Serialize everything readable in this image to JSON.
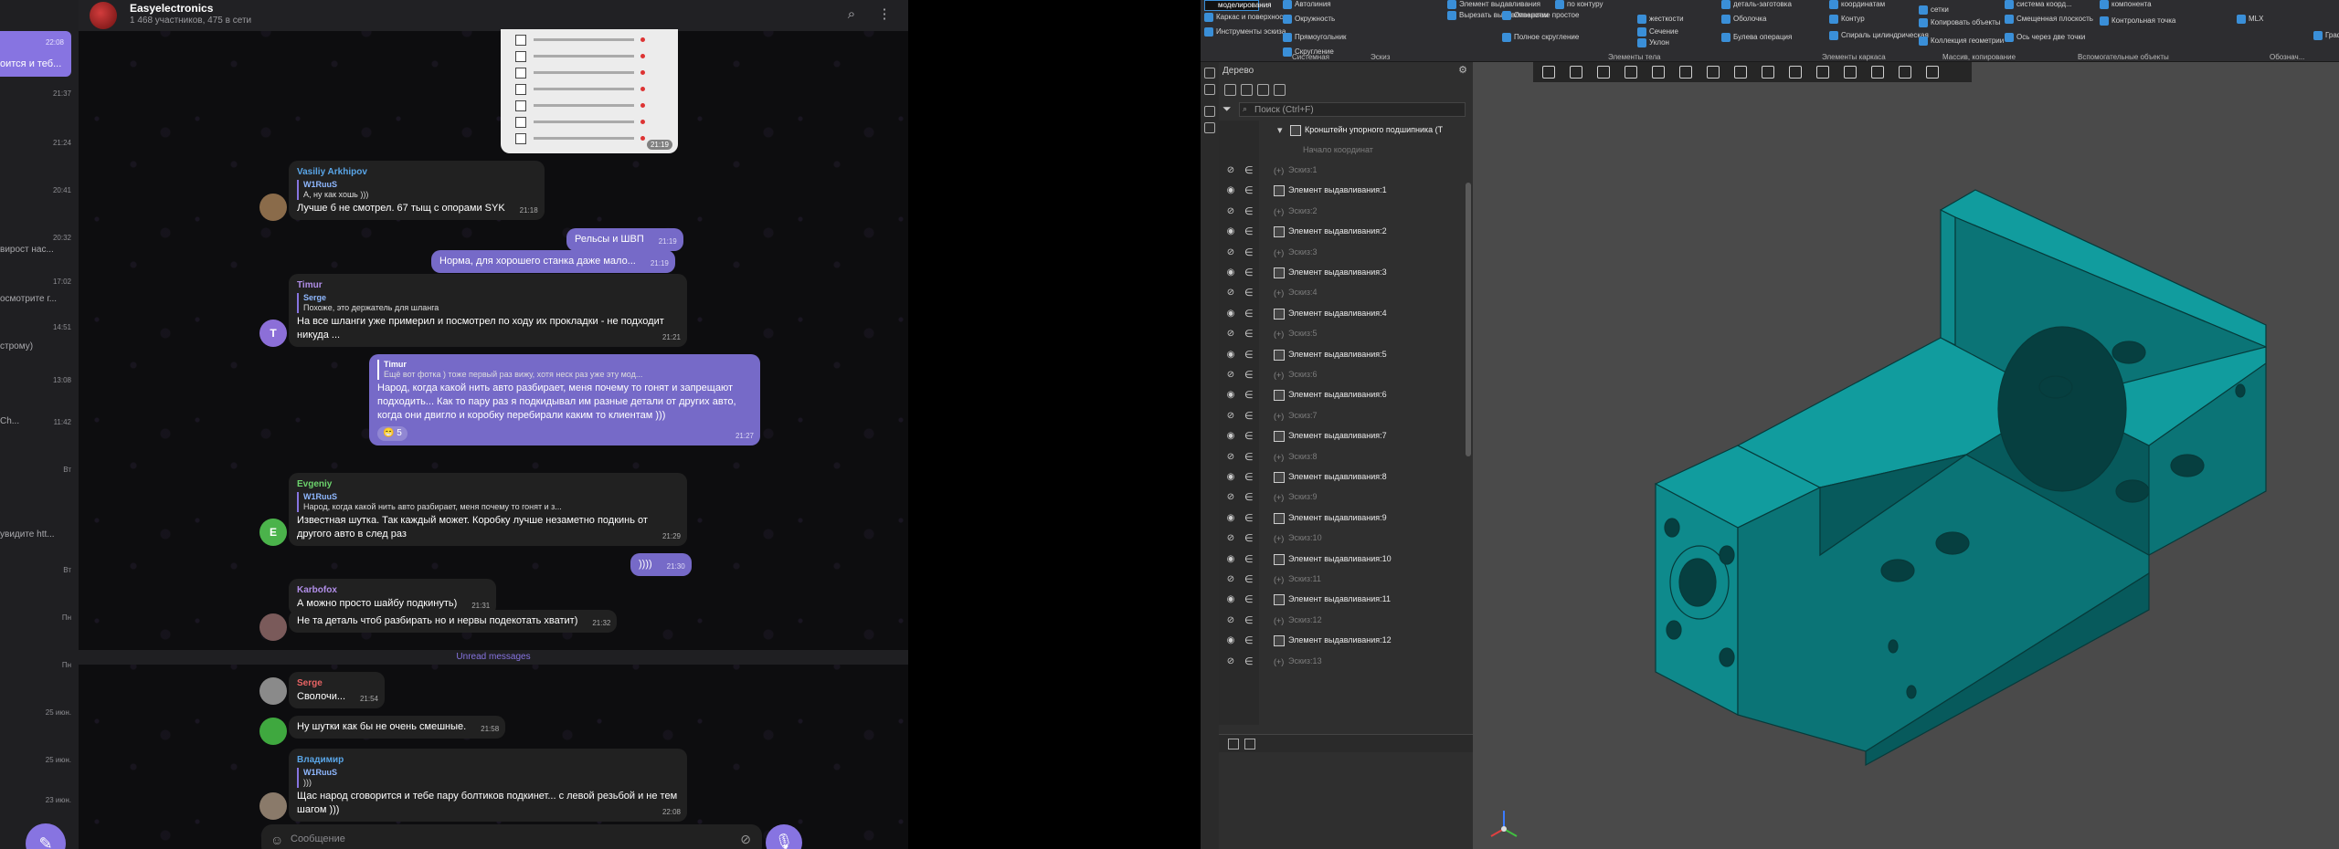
{
  "chat_list": {
    "items": [
      {
        "snippet": "",
        "time": "22:08",
        "active": true,
        "snippet_active": "оится и теб..."
      },
      {
        "snippet": "",
        "time": "21:37"
      },
      {
        "snippet": "",
        "time": "21:24"
      },
      {
        "snippet": "",
        "time": "20:41"
      },
      {
        "snippet": "",
        "time": "20:32"
      },
      {
        "snippet": "вирост нас...",
        "time": ""
      },
      {
        "snippet": "",
        "time": "17:02"
      },
      {
        "snippet": "осмотрите г...",
        "time": ""
      },
      {
        "snippet": "",
        "time": "14:51"
      },
      {
        "snippet": "строму)",
        "time": ""
      },
      {
        "snippet": "",
        "time": "13:08"
      },
      {
        "snippet": "Ch...",
        "time": "11:42"
      },
      {
        "snippet": "",
        "time": "Вт"
      },
      {
        "snippet": "увидите htt...",
        "time": ""
      },
      {
        "snippet": "",
        "time": "Вт"
      },
      {
        "snippet": "",
        "time": "Пн"
      },
      {
        "snippet": "",
        "time": "Пн"
      },
      {
        "snippet": "",
        "time": "25 июн."
      },
      {
        "snippet": "",
        "time": "25 июн."
      },
      {
        "snippet": "",
        "time": "23 июн."
      }
    ]
  },
  "chat": {
    "title": "Easyelectronics",
    "subtitle": "1 468 участников, 475 в сети",
    "doc_time": "21:19",
    "unread_label": "Unread messages",
    "composer_placeholder": "Сообщение",
    "messages": [
      {
        "id": "m1",
        "dir": "in",
        "author": "Vasiliy Arkhipov",
        "author_color": "#5aa6e8",
        "quote_author": "W1RuuS",
        "quote_text": "А, ну как хошь )))",
        "text": "Лучше б не смотрел. 67 тыщ с опорами SYK",
        "time": "21:18",
        "avatar_letter": ""
      },
      {
        "id": "m2",
        "dir": "out",
        "text": "Рельсы и ШВП",
        "time": "21:19"
      },
      {
        "id": "m3",
        "dir": "out",
        "text": "Норма, для хорошего станка даже мало...",
        "time": "21:19"
      },
      {
        "id": "m4",
        "dir": "in",
        "author": "Timur",
        "author_color": "#b18ee8",
        "quote_author": "Serge",
        "quote_text": "Похоже, это держатель для шланга",
        "text": "На все шланги уже примерил и посмотрел по ходу их прокладки - не подходит никуда ...",
        "time": "21:21",
        "avatar_letter": "T"
      },
      {
        "id": "m5",
        "dir": "out",
        "quote_author": "Timur",
        "quote_text": "Ещё вот фотка ) тоже первый раз вижу, хотя неск раз уже эту мод...",
        "text": "Народ, когда какой нить авто разбирает, меня почему то гонят и запрещают подходить... Как то пару раз я подкидывал им разные детали от других авто, когда они двигло и коробку перебирали каким то клиентам )))",
        "time": "21:27",
        "reaction": "😁 5"
      },
      {
        "id": "m6",
        "dir": "in",
        "author": "Evgeniy",
        "author_color": "#6cd36c",
        "quote_author": "W1RuuS",
        "quote_text": "Народ, когда какой нить авто разбирает, меня почему то гонят и з...",
        "text": "Известная шутка. Так каждый может. Коробку лучше незаметно подкинь от другого авто в след раз",
        "time": "21:29",
        "avatar_letter": "E"
      },
      {
        "id": "m7",
        "dir": "out",
        "text": "))))",
        "time": "21:30"
      },
      {
        "id": "m8",
        "dir": "in",
        "author": "Karbofox",
        "author_color": "#b18ee8",
        "text": "А можно просто шайбу подкинуть)",
        "time": "21:31"
      },
      {
        "id": "m9",
        "dir": "in",
        "text": "Не та деталь чтоб разбирать но и нервы подекотать хватит)",
        "time": "21:32"
      },
      {
        "id": "m10",
        "dir": "in",
        "author": "Serge",
        "author_color": "#e86464",
        "text": "Сволочи...",
        "time": "21:54"
      },
      {
        "id": "m11",
        "dir": "in",
        "text": "Ну шутки как бы не очень смешные.",
        "time": "21:58"
      },
      {
        "id": "m12",
        "dir": "in",
        "author": "Владимир",
        "author_color": "#5aa6e8",
        "quote_author": "W1RuuS",
        "quote_text": ")))",
        "text": "Щас народ сговорится и тебе пару болтиков подкинет... с левой резьбой и не тем шагом )))",
        "time": "22:08"
      }
    ]
  },
  "cad": {
    "ribbon": {
      "items": [
        "моделирования",
        "Каркас и поверхности",
        "Инструменты эскиза",
        "Автолиния",
        "Окружность",
        "Прямоугольник",
        "Скругление",
        "Элемент выдавливания",
        "Вырезать выдавливанием",
        "Отверстие простое",
        "Полное скругление",
        "по контуру",
        "жесткости",
        "Сечение",
        "Уклон",
        "деталь-заготовка",
        "Оболочка",
        "Булева операция",
        "координатам",
        "Контур",
        "Спираль цилиндрическая",
        "сетки",
        "Копировать объекты",
        "Коллекция геометрии",
        "система коорд...",
        "Смещенная плоскость",
        "Ось через две точки",
        "компонента",
        "Контрольная точка",
        "MLX",
        "Графи..."
      ],
      "groups": [
        "Системная",
        "Эскиз",
        "Элементы тела",
        "Элементы каркаса",
        "Массив, копирование",
        "Вспомогательные объекты",
        "Обознач..."
      ]
    },
    "tree": {
      "title": "Дерево",
      "search_placeholder": "Поиск (Ctrl+F)",
      "root": "Кронштейн упорного подшипника (Т",
      "origin": "Начало координат",
      "rows": [
        {
          "label": "Эскиз:1",
          "kind": "sketch"
        },
        {
          "label": "Элемент выдавливания:1",
          "kind": "extrude"
        },
        {
          "label": "Эскиз:2",
          "kind": "sketch"
        },
        {
          "label": "Элемент выдавливания:2",
          "kind": "extrude"
        },
        {
          "label": "Эскиз:3",
          "kind": "sketch"
        },
        {
          "label": "Элемент выдавливания:3",
          "kind": "extrude"
        },
        {
          "label": "Эскиз:4",
          "kind": "sketch"
        },
        {
          "label": "Элемент выдавливания:4",
          "kind": "extrude"
        },
        {
          "label": "Эскиз:5",
          "kind": "sketch"
        },
        {
          "label": "Элемент выдавливания:5",
          "kind": "extrude"
        },
        {
          "label": "Эскиз:6",
          "kind": "sketch"
        },
        {
          "label": "Элемент выдавливания:6",
          "kind": "extrude"
        },
        {
          "label": "Эскиз:7",
          "kind": "sketch"
        },
        {
          "label": "Элемент выдавливания:7",
          "kind": "extrude"
        },
        {
          "label": "Эскиз:8",
          "kind": "sketch"
        },
        {
          "label": "Элемент выдавливания:8",
          "kind": "extrude"
        },
        {
          "label": "Эскиз:9",
          "kind": "sketch"
        },
        {
          "label": "Элемент выдавливания:9",
          "kind": "extrude"
        },
        {
          "label": "Эскиз:10",
          "kind": "sketch"
        },
        {
          "label": "Элемент выдавливания:10",
          "kind": "extrude"
        },
        {
          "label": "Эскиз:11",
          "kind": "sketch"
        },
        {
          "label": "Элемент выдавливания:11",
          "kind": "extrude"
        },
        {
          "label": "Эскиз:12",
          "kind": "sketch"
        },
        {
          "label": "Элемент выдавливания:12",
          "kind": "extrude"
        },
        {
          "label": "Эскиз:13",
          "kind": "sketch"
        }
      ]
    },
    "model_color": "#0e8a8c"
  }
}
